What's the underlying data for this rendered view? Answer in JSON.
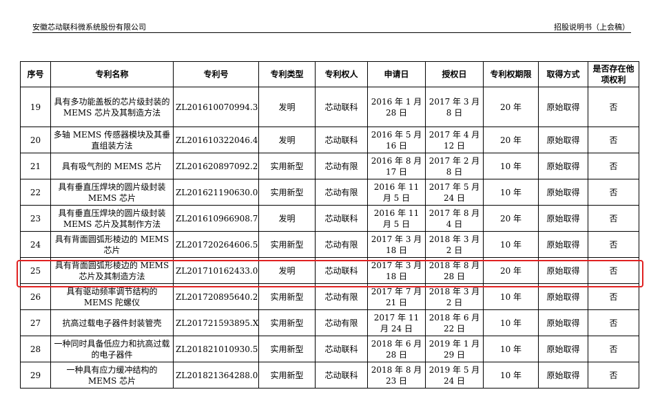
{
  "header": {
    "company": "安徽芯动联科微系统股份有限公司",
    "doc_title": "招股说明书（上会稿）"
  },
  "table": {
    "columns": [
      "序号",
      "专利名称",
      "专利号",
      "专利类型",
      "专利权人",
      "申请日",
      "授权日",
      "专利权期限",
      "取得方式",
      "是否存在他项权利"
    ],
    "rows": [
      {
        "no": "19",
        "name": "具有多功能盖板的芯片级封装的 MEMS 芯片及其制造方法",
        "number": "ZL201610070994.3",
        "type": "发明",
        "owner": "芯动联科",
        "apply": "2016 年 1 月 28 日",
        "grant": "2017 年 3 月 8 日",
        "term": "20 年",
        "method": "原始取得",
        "encumbrance": "否"
      },
      {
        "no": "20",
        "name": "多轴 MEMS 传感器模块及其垂直组装方法",
        "number": "ZL201610322046.4",
        "type": "发明",
        "owner": "芯动联科",
        "apply": "2016 年 5 月 16 日",
        "grant": "2017 年 4 月 12 日",
        "term": "20 年",
        "method": "原始取得",
        "encumbrance": "否"
      },
      {
        "no": "21",
        "name": "具有吸气剂的 MEMS 芯片",
        "number": "ZL201620897092.2",
        "type": "实用新型",
        "owner": "芯动有限",
        "apply": "2016 年 8 月 17 日",
        "grant": "2017 年 2 月 8 日",
        "term": "10 年",
        "method": "原始取得",
        "encumbrance": "否"
      },
      {
        "no": "22",
        "name": "具有垂直压焊块的圆片级封装 MEMS 芯片",
        "number": "ZL201621190630.0",
        "type": "实用新型",
        "owner": "芯动有限",
        "apply": "2016 年 11 月 5 日",
        "grant": "2017 年 5 月 24 日",
        "term": "10 年",
        "method": "原始取得",
        "encumbrance": "否"
      },
      {
        "no": "23",
        "name": "具有垂直压焊块的圆片级封装 MEMS 芯片及其制作方法",
        "number": "ZL201610966908.7",
        "type": "发明",
        "owner": "芯动联科",
        "apply": "2016 年 11 月 5 日",
        "grant": "2017 年 8 月 4 日",
        "term": "20 年",
        "method": "原始取得",
        "encumbrance": "否"
      },
      {
        "no": "24",
        "name": "具有背面圆弧形棱边的 MEMS 芯片",
        "number": "ZL201720264606.5",
        "type": "实用新型",
        "owner": "芯动有限",
        "apply": "2017 年 3 月 18 日",
        "grant": "2018 年 3 月 2 日",
        "term": "10 年",
        "method": "原始取得",
        "encumbrance": "否"
      },
      {
        "no": "25",
        "name": "具有背面圆弧形棱边的 MEMS 芯片及其制造方法",
        "number": "ZL201710162433.0",
        "type": "发明",
        "owner": "芯动联科",
        "apply": "2017 年 3 月 18 日",
        "grant": "2018 年 8 月 28 日",
        "term": "20 年",
        "method": "原始取得",
        "encumbrance": "否"
      },
      {
        "no": "26",
        "name": "具有驱动频率调节结构的 MEMS 陀螺仪",
        "number": "ZL201720895640.2",
        "type": "实用新型",
        "owner": "芯动有限",
        "apply": "2017 年 7 月 21 日",
        "grant": "2018 年 3 月 2 日",
        "term": "10 年",
        "method": "原始取得",
        "encumbrance": "否"
      },
      {
        "no": "27",
        "name": "抗高过载电子器件封装管壳",
        "number": "ZL201721593895.X",
        "type": "实用新型",
        "owner": "芯动有限",
        "apply": "2017 年 11 月 24 日",
        "grant": "2018 年 6 月 22 日",
        "term": "10 年",
        "method": "原始取得",
        "encumbrance": "否"
      },
      {
        "no": "28",
        "name": "一种同时具备低应力和抗高过载的电子器件",
        "number": "ZL201821010930.5",
        "type": "实用新型",
        "owner": "芯动联科",
        "apply": "2018 年 6 月 28 日",
        "grant": "2019 年 1 月 29 日",
        "term": "10 年",
        "method": "原始取得",
        "encumbrance": "否"
      },
      {
        "no": "29",
        "name": "一种具有应力缓冲结构的 MEMS 芯片",
        "number": "ZL201821364288.0",
        "type": "实用新型",
        "owner": "芯动联科",
        "apply": "2018 年 8 月 23 日",
        "grant": "2019 年 5 月 24 日",
        "term": "10 年",
        "method": "原始取得",
        "encumbrance": "否"
      }
    ]
  },
  "highlight": {
    "row_no": "25",
    "color": "#e02020"
  }
}
